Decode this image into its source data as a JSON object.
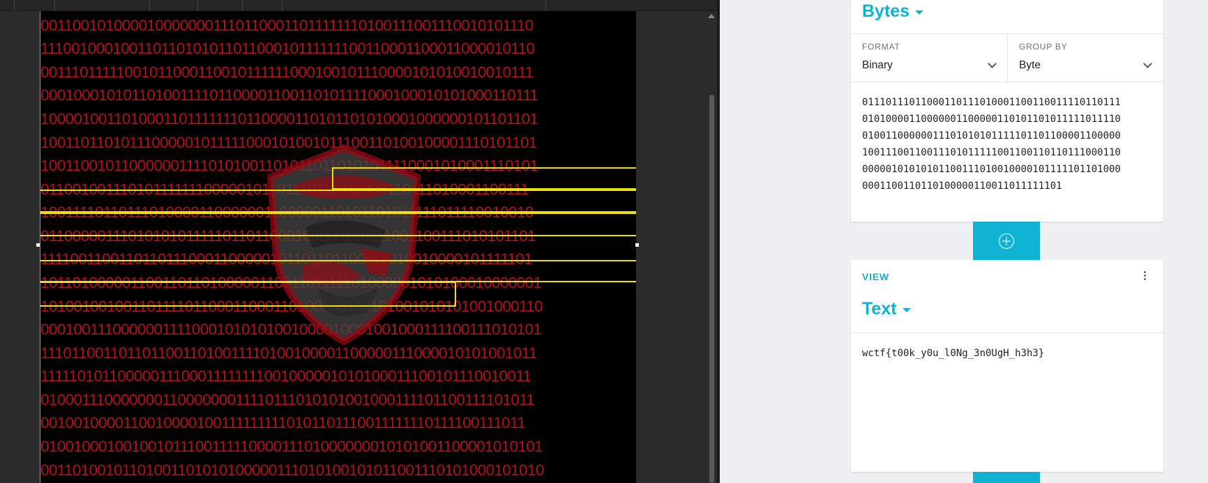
{
  "editor": {
    "binary_rows": [
      "00110010100001000000011101100011011111110100111001110010101110",
      "11100100010011011010101101100010111111100110001100011000010110",
      "00111011111001011000110010111111000100101110000101010010010111",
      "00010001010110100111101100001100110101111000100010101000110111",
      "10000100110100011011111110110000110101101010001000000101101101",
      "10011011010111000001011111000101001011100110100100001110101101",
      "10011001011000000111101010011010110110101011110001010001110101",
      "01100100111010111111100000101101110111011000110111010001100111",
      "10011110110111010000110000001100000110101101011111011110010010",
      "01100000111010101011111011011000100000100111001100111010101101",
      "11110011001101101110001100000101101101100111010010000101111101",
      "10110100000110011011010000011001101111101000001010100010000001",
      "10100100100110111101100011000110100100110101001010101001000110",
      "00010011100000011110001010101001000010001001000111100111010101",
      "11101100110110110011010011110100100001100000111000010101001011",
      "11111010110000011100011111111001000001010100011100101110010011",
      "01000111000000011000000011110111010101001000111101100111101011",
      "00100100001100100001001111111110101101110011111110111100111011",
      "01001000100100101110011111000011101000000010101001100001010101",
      "00110100101101001101010100000111010100101011001110101000101010"
    ]
  },
  "input_card": {
    "title": "Bytes",
    "format_label": "FORMAT",
    "format_value": "Binary",
    "group_label": "GROUP BY",
    "group_value": "Byte",
    "bits": [
      "01110111011000110111010001100110011110110111",
      "01010000110000001100000110101101011111011110",
      "01001100000011101010101111101101100001100000",
      "10011100110011101011111001100110110111000110",
      "00000101010101100111010010000101111101101000",
      "0001100110110100000110011011111101"
    ]
  },
  "view_card": {
    "section": "VIEW",
    "title": "Text",
    "output": "wctf{t00k_y0u_l0Ng_3n0UgH_h3h3}"
  },
  "colors": {
    "accent": "#0fb3d1",
    "binary_text": "#b4111b",
    "selection": "#f0e010"
  }
}
